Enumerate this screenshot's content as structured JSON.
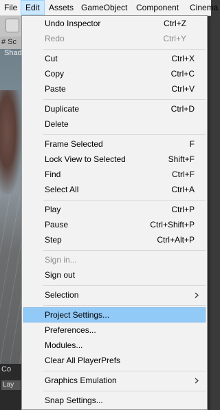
{
  "menubar": {
    "items": [
      "File",
      "Edit",
      "Assets",
      "GameObject",
      "Component",
      "Cinema"
    ]
  },
  "scene": {
    "tab_label": "# Sc",
    "sub_label": "Shad",
    "bottom_tab": "Co",
    "bottom_field": "Lay"
  },
  "edit_menu": {
    "items": [
      {
        "label": "Undo Inspector",
        "shortcut": "Ctrl+Z"
      },
      {
        "label": "Redo",
        "shortcut": "Ctrl+Y"
      },
      {
        "label": "Cut",
        "shortcut": "Ctrl+X"
      },
      {
        "label": "Copy",
        "shortcut": "Ctrl+C"
      },
      {
        "label": "Paste",
        "shortcut": "Ctrl+V"
      },
      {
        "label": "Duplicate",
        "shortcut": "Ctrl+D"
      },
      {
        "label": "Delete",
        "shortcut": ""
      },
      {
        "label": "Frame Selected",
        "shortcut": "F"
      },
      {
        "label": "Lock View to Selected",
        "shortcut": "Shift+F"
      },
      {
        "label": "Find",
        "shortcut": "Ctrl+F"
      },
      {
        "label": "Select All",
        "shortcut": "Ctrl+A"
      },
      {
        "label": "Play",
        "shortcut": "Ctrl+P"
      },
      {
        "label": "Pause",
        "shortcut": "Ctrl+Shift+P"
      },
      {
        "label": "Step",
        "shortcut": "Ctrl+Alt+P"
      },
      {
        "label": "Sign in...",
        "shortcut": ""
      },
      {
        "label": "Sign out",
        "shortcut": ""
      },
      {
        "label": "Selection",
        "shortcut": ""
      },
      {
        "label": "Project Settings...",
        "shortcut": ""
      },
      {
        "label": "Preferences...",
        "shortcut": ""
      },
      {
        "label": "Modules...",
        "shortcut": ""
      },
      {
        "label": "Clear All PlayerPrefs",
        "shortcut": ""
      },
      {
        "label": "Graphics Emulation",
        "shortcut": ""
      },
      {
        "label": "Snap Settings...",
        "shortcut": ""
      }
    ]
  },
  "colors": {
    "highlight": "#91c9f7",
    "open_menu": "#cce8ff",
    "disabled_text": "#8d8d8d"
  }
}
